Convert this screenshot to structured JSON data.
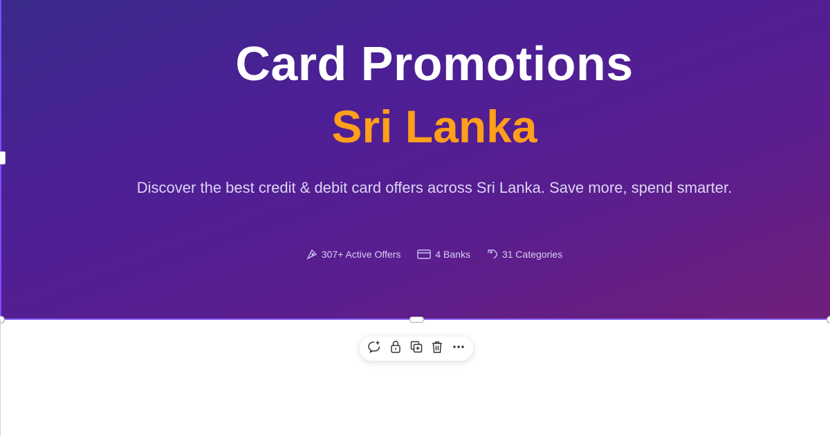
{
  "hero": {
    "title": "Card Promotions",
    "accent_title": "Sri Lanka",
    "description": "Discover the best credit & debit card offers across Sri Lanka. Save more, spend smarter.",
    "accent_color": "#ff9f1a",
    "stats": [
      {
        "icon": "tag-icon",
        "label": "307+ Active Offers"
      },
      {
        "icon": "credit-card-icon",
        "label": "4 Banks"
      },
      {
        "icon": "label-icon",
        "label": "31 Categories"
      }
    ]
  },
  "toolbar": {
    "items": [
      {
        "icon": "add-comment-icon"
      },
      {
        "icon": "lock-icon"
      },
      {
        "icon": "duplicate-icon"
      },
      {
        "icon": "delete-icon"
      },
      {
        "icon": "more-icon"
      }
    ]
  },
  "colors": {
    "selection": "#8a63ff",
    "hero_gradient_start": "#3a2a8a",
    "hero_gradient_end": "#6f1f7a"
  }
}
